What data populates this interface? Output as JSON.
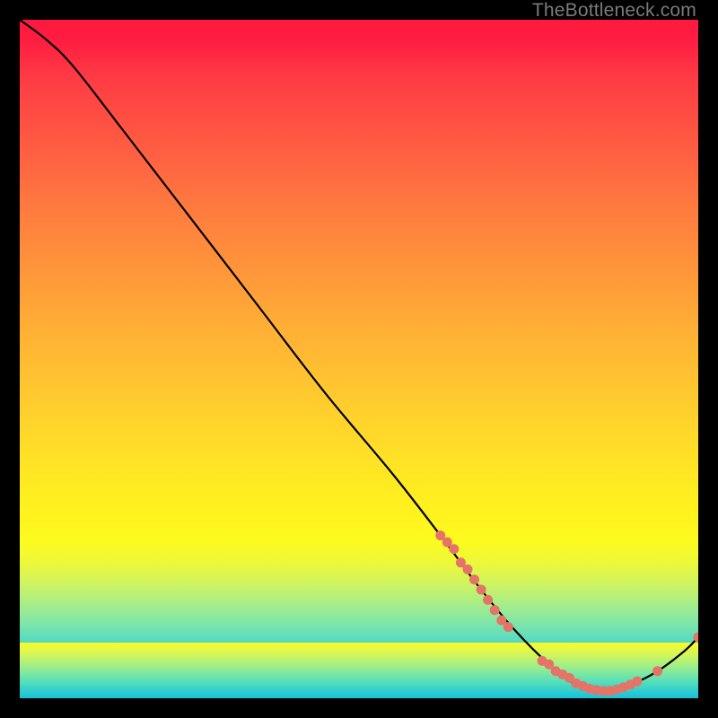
{
  "watermark": "TheBottleneck.com",
  "colors": {
    "curve": "#000000",
    "points": "#e57368",
    "background_outer": "#000000"
  },
  "chart_data": {
    "type": "line",
    "title": "",
    "xlabel": "",
    "ylabel": "",
    "xlim": [
      0,
      100
    ],
    "ylim": [
      0,
      100
    ],
    "grid": false,
    "legend": false,
    "curve": [
      {
        "x": 0,
        "y": 100
      },
      {
        "x": 4,
        "y": 97
      },
      {
        "x": 8,
        "y": 93
      },
      {
        "x": 15,
        "y": 84
      },
      {
        "x": 25,
        "y": 71
      },
      {
        "x": 35,
        "y": 58
      },
      {
        "x": 45,
        "y": 45
      },
      {
        "x": 55,
        "y": 33
      },
      {
        "x": 62,
        "y": 24
      },
      {
        "x": 68,
        "y": 16
      },
      {
        "x": 73,
        "y": 10
      },
      {
        "x": 78,
        "y": 5
      },
      {
        "x": 82,
        "y": 2
      },
      {
        "x": 86,
        "y": 1
      },
      {
        "x": 90,
        "y": 2
      },
      {
        "x": 94,
        "y": 4
      },
      {
        "x": 98,
        "y": 7
      },
      {
        "x": 100,
        "y": 9
      }
    ],
    "marker_clusters": [
      {
        "x": 62,
        "y": 24
      },
      {
        "x": 63,
        "y": 23
      },
      {
        "x": 64,
        "y": 22
      },
      {
        "x": 65,
        "y": 20
      },
      {
        "x": 66,
        "y": 19
      },
      {
        "x": 67,
        "y": 17.5
      },
      {
        "x": 68,
        "y": 16
      },
      {
        "x": 69,
        "y": 14.5
      },
      {
        "x": 70,
        "y": 13
      },
      {
        "x": 71,
        "y": 11.5
      },
      {
        "x": 72,
        "y": 10.5
      },
      {
        "x": 77,
        "y": 5.5
      },
      {
        "x": 78,
        "y": 5
      },
      {
        "x": 79,
        "y": 4
      },
      {
        "x": 80,
        "y": 3.5
      },
      {
        "x": 81,
        "y": 3
      },
      {
        "x": 82,
        "y": 2.2
      },
      {
        "x": 83,
        "y": 1.8
      },
      {
        "x": 84,
        "y": 1.4
      },
      {
        "x": 85,
        "y": 1.2
      },
      {
        "x": 86,
        "y": 1.1
      },
      {
        "x": 87,
        "y": 1.1
      },
      {
        "x": 88,
        "y": 1.3
      },
      {
        "x": 89,
        "y": 1.6
      },
      {
        "x": 90,
        "y": 2.0
      },
      {
        "x": 91,
        "y": 2.5
      },
      {
        "x": 94,
        "y": 4.0
      },
      {
        "x": 100,
        "y": 9.0
      }
    ]
  }
}
